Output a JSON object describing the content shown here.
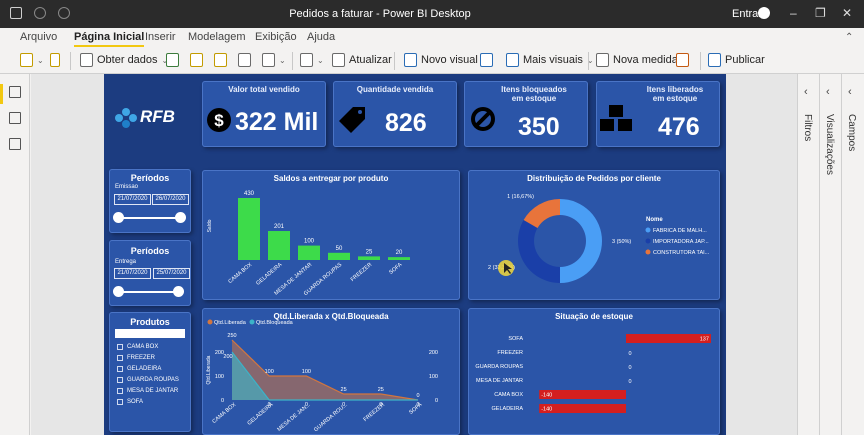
{
  "window": {
    "title": "Pedidos a faturar - Power BI Desktop",
    "signin": "Entrar"
  },
  "menu": {
    "tabs": [
      "Arquivo",
      "Página Inicial",
      "Inserir",
      "Modelagem",
      "Exibição",
      "Ajuda"
    ],
    "active": "Página Inicial"
  },
  "ribbon": {
    "get_data": "Obter dados",
    "refresh": "Atualizar",
    "new_visual": "Novo visual",
    "more_visuals": "Mais visuais",
    "new_measure": "Nova medida",
    "publish": "Publicar"
  },
  "right_panes": [
    "Filtros",
    "Visualizações",
    "Campos"
  ],
  "report": {
    "logo_text": "RFB",
    "kpis": [
      {
        "title": "Valor total vendido",
        "value": "322 Mil",
        "icon": "dollar-icon"
      },
      {
        "title": "Quantidade vendida",
        "value": "826",
        "icon": "price-tag-icon"
      },
      {
        "title": "Itens bloqueados em estoque",
        "value": "350",
        "icon": "blocked-icon"
      },
      {
        "title": "Itens liberados em estoque",
        "value": "476",
        "icon": "boxes-icon"
      }
    ],
    "slicer_emissao": {
      "title": "Períodos",
      "label": "Emissao",
      "start": "21/07/2020",
      "end": "26/07/2020"
    },
    "slicer_entrega": {
      "title": "Períodos",
      "label": "Entrega",
      "start": "21/07/2020",
      "end": "25/07/2020"
    },
    "slicer_produtos": {
      "title": "Produtos",
      "items": [
        "CAMA BOX",
        "FREEZER",
        "GELADEIRA",
        "GUARDA ROUPAS",
        "MESA DE JANTAR",
        "SOFA"
      ]
    }
  },
  "chart_data": [
    {
      "type": "bar",
      "title": "Saldos a entregar por produto",
      "ylabel": "Saldo",
      "categories": [
        "CAMA BOX",
        "GELADEIRA",
        "MESA DE JANTAR",
        "GUARDA ROUPAS",
        "FREEZER",
        "SOFA"
      ],
      "values": [
        430,
        201,
        100,
        50,
        25,
        20
      ],
      "color": "#3ddb4a",
      "data_labels": true
    },
    {
      "type": "pie",
      "title": "Distribuição de Pedidos por cliente",
      "legend_title": "Nome",
      "legend_position": "right",
      "series": [
        {
          "name": "FABRICA DE MALH...",
          "value": 3,
          "label": "3 (50%)",
          "color": "#4a9ef5"
        },
        {
          "name": "IMPORTADORA JAP...",
          "value": 2,
          "label": "2 (33,33%)",
          "color": "#1a3fa8"
        },
        {
          "name": "CONSTRUTORA TAI...",
          "value": 1,
          "label": "1 (16,67%)",
          "color": "#e8743b"
        }
      ]
    },
    {
      "type": "area",
      "title": "Qtd.Liberada x Qtd.Bloqueada",
      "ylabel": "Qtd.Liberada",
      "categories": [
        "CAMA BOX",
        "GELADEIRA",
        "MESA DE JAN...",
        "GUARDA ROU...",
        "FREEZER",
        "SOFA"
      ],
      "ylim": [
        0,
        200
      ],
      "y_ticks": [
        0,
        100,
        200
      ],
      "series": [
        {
          "name": "Qtd.Liberada",
          "values": [
            250,
            100,
            100,
            25,
            25,
            0
          ],
          "color": "#d2763f"
        },
        {
          "name": "Qtd.Bloqueada",
          "values": [
            200,
            0,
            0,
            0,
            0,
            0
          ],
          "color": "#3cb3c8"
        }
      ]
    },
    {
      "type": "bar",
      "title": "Situação de estoque",
      "orientation": "horizontal",
      "categories": [
        "SOFA",
        "FREEZER",
        "GUARDA ROUPAS",
        "MESA DE JANTAR",
        "CAMA BOX",
        "GELADEIRA"
      ],
      "values": [
        137,
        0,
        0,
        0,
        -140,
        -140
      ],
      "value_labels": [
        "137",
        "0",
        "0",
        "0",
        "-140",
        "-140"
      ],
      "color": "#d41f1f"
    }
  ]
}
